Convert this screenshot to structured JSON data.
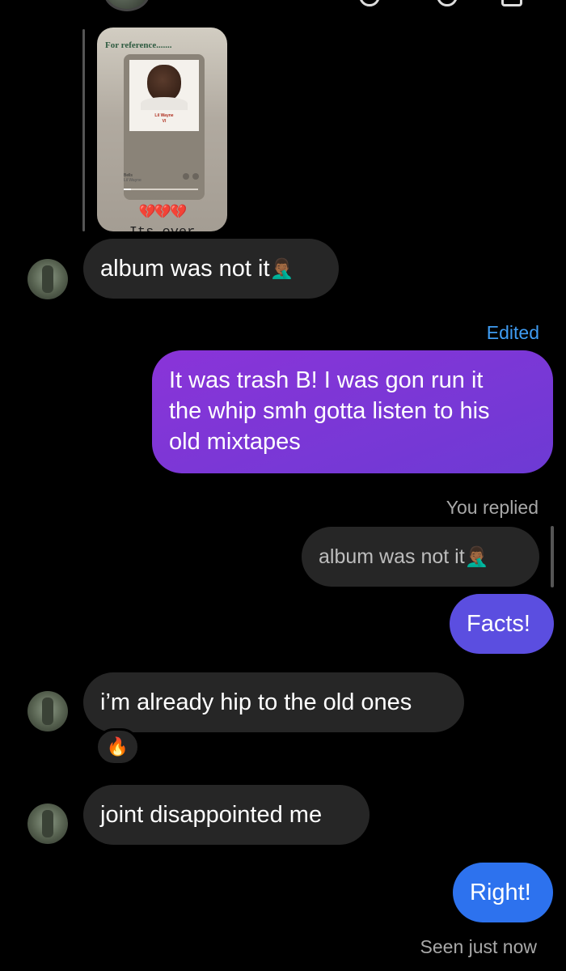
{
  "story": {
    "title": "For reference.......",
    "album_artist": "Lil Wayne",
    "album_title": "VI",
    "song": "Bells",
    "hearts": "💔💔💔",
    "caption": "Its over"
  },
  "messages": [
    {
      "direction": "in",
      "text": "album was not it",
      "emoji": "🤦🏾‍♂️"
    },
    {
      "direction": "out",
      "status": "Edited",
      "text_lines": [
        "It was trash B! I was gon run it",
        "the whip smh gotta listen to his",
        "old mixtapes"
      ]
    },
    {
      "direction": "out",
      "replied_label": "You replied",
      "quoted_text": "album was not it",
      "quoted_emoji": "🤦🏾‍♂️",
      "text": "Facts!"
    },
    {
      "direction": "in",
      "text": "i’m already hip to the old ones",
      "reaction": "🔥"
    },
    {
      "direction": "in",
      "text": "joint disappointed me"
    },
    {
      "direction": "out",
      "text": "Right!",
      "status": "Seen just now"
    }
  ],
  "colors": {
    "background": "#000000",
    "incoming_bubble": "#262626",
    "outgoing_purple": "#7a37d6",
    "outgoing_indigo": "#5b4ee0",
    "outgoing_blue": "#2d72ee",
    "edited_label": "#3f9cf2"
  },
  "icons": [
    "avatar",
    "story-reply-line"
  ]
}
